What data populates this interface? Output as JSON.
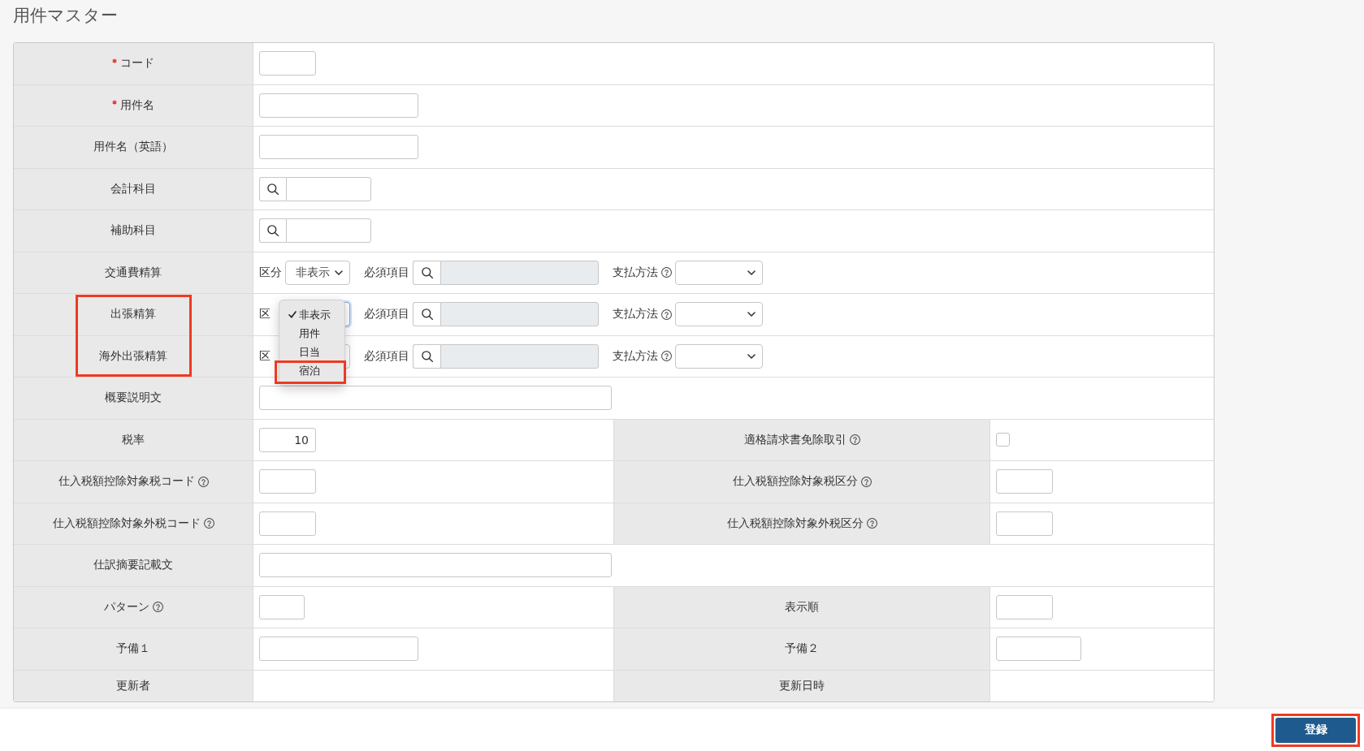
{
  "page": {
    "title": "用件マスター"
  },
  "form": {
    "rows": [
      {
        "items": [
          {
            "label": "コード",
            "required": true,
            "help": false,
            "highlighted": false,
            "field": {
              "kind": "code"
            }
          }
        ]
      },
      {
        "items": [
          {
            "label": "用件名",
            "required": true,
            "help": false,
            "highlighted": false,
            "field": {
              "kind": "name"
            }
          }
        ]
      },
      {
        "items": [
          {
            "label": "用件名（英語）",
            "required": false,
            "help": false,
            "highlighted": false,
            "field": {
              "kind": "name"
            }
          }
        ]
      },
      {
        "items": [
          {
            "label": "会計科目",
            "required": false,
            "help": false,
            "highlighted": false,
            "field": {
              "kind": "lookup",
              "disabled": false
            }
          }
        ]
      },
      {
        "items": [
          {
            "label": "補助科目",
            "required": false,
            "help": false,
            "highlighted": false,
            "field": {
              "kind": "lookup",
              "disabled": false
            }
          }
        ]
      },
      {
        "items": [
          {
            "label": "交通費精算",
            "required": false,
            "help": false,
            "highlighted": false,
            "field": {
              "kind": "expense",
              "category": {
                "label": "区分",
                "value": "非表示",
                "open": false
              },
              "required_items": {
                "label": "必須項目",
                "disabled": true
              },
              "payment": {
                "label": "支払方法",
                "help": true
              }
            }
          }
        ]
      },
      {
        "items": [
          {
            "label": "出張精算",
            "required": false,
            "help": false,
            "highlighted": true,
            "field": {
              "kind": "expense",
              "category": {
                "label": "区",
                "open": true,
                "options": [
                  {
                    "label": "非表示",
                    "selected": true,
                    "highlighted": false
                  },
                  {
                    "label": "用件",
                    "selected": false,
                    "highlighted": false
                  },
                  {
                    "label": "日当",
                    "selected": false,
                    "highlighted": false
                  },
                  {
                    "label": "宿泊",
                    "selected": false,
                    "highlighted": true
                  }
                ]
              },
              "required_items": {
                "label": "必須項目",
                "disabled": true
              },
              "payment": {
                "label": "支払方法",
                "help": true
              }
            }
          }
        ]
      },
      {
        "items": [
          {
            "label": "海外出張精算",
            "required": false,
            "help": false,
            "highlighted": true,
            "field": {
              "kind": "expense",
              "category": {
                "label": "区",
                "open": false
              },
              "required_items": {
                "label": "必須項目",
                "disabled": true
              },
              "payment": {
                "label": "支払方法",
                "help": true
              }
            }
          }
        ]
      },
      {
        "items": [
          {
            "label": "概要説明文",
            "required": false,
            "help": false,
            "highlighted": false,
            "field": {
              "kind": "sentence"
            }
          }
        ]
      },
      {
        "items": [
          {
            "label": "税率",
            "required": false,
            "help": false,
            "highlighted": false,
            "field": {
              "kind": "number",
              "value": "10"
            }
          },
          {
            "label": "適格請求書免除取引",
            "required": false,
            "help": true,
            "highlighted": false,
            "field": {
              "kind": "checkbox",
              "checked": false
            }
          }
        ]
      },
      {
        "items": [
          {
            "label": "仕入税額控除対象税コード",
            "required": false,
            "help": true,
            "highlighted": false,
            "field": {
              "kind": "code"
            }
          },
          {
            "label": "仕入税額控除対象税区分",
            "required": false,
            "help": true,
            "highlighted": false,
            "field": {
              "kind": "code"
            }
          }
        ]
      },
      {
        "items": [
          {
            "label": "仕入税額控除対象外税コード",
            "required": false,
            "help": true,
            "highlighted": false,
            "field": {
              "kind": "code"
            }
          },
          {
            "label": "仕入税額控除対象外税区分",
            "required": false,
            "help": true,
            "highlighted": false,
            "field": {
              "kind": "code"
            }
          }
        ]
      },
      {
        "items": [
          {
            "label": "仕訳摘要記載文",
            "required": false,
            "help": false,
            "highlighted": false,
            "field": {
              "kind": "sentence"
            }
          }
        ]
      },
      {
        "items": [
          {
            "label": "パターン",
            "required": false,
            "help": true,
            "highlighted": false,
            "field": {
              "kind": "pattern"
            }
          },
          {
            "label": "表示順",
            "required": false,
            "help": false,
            "highlighted": false,
            "field": {
              "kind": "code"
            }
          }
        ]
      },
      {
        "items": [
          {
            "label": "予備１",
            "required": false,
            "help": false,
            "highlighted": false,
            "field": {
              "kind": "name"
            }
          },
          {
            "label": "予備２",
            "required": false,
            "help": false,
            "highlighted": false,
            "field": {
              "kind": "note"
            }
          }
        ]
      },
      {
        "items": [
          {
            "label": "更新者",
            "required": false,
            "help": false,
            "highlighted": false
          },
          {
            "label": "更新日時",
            "required": false,
            "help": false,
            "highlighted": false
          }
        ]
      }
    ]
  },
  "footer": {
    "submit": {
      "label": "登録",
      "highlighted": true
    }
  }
}
